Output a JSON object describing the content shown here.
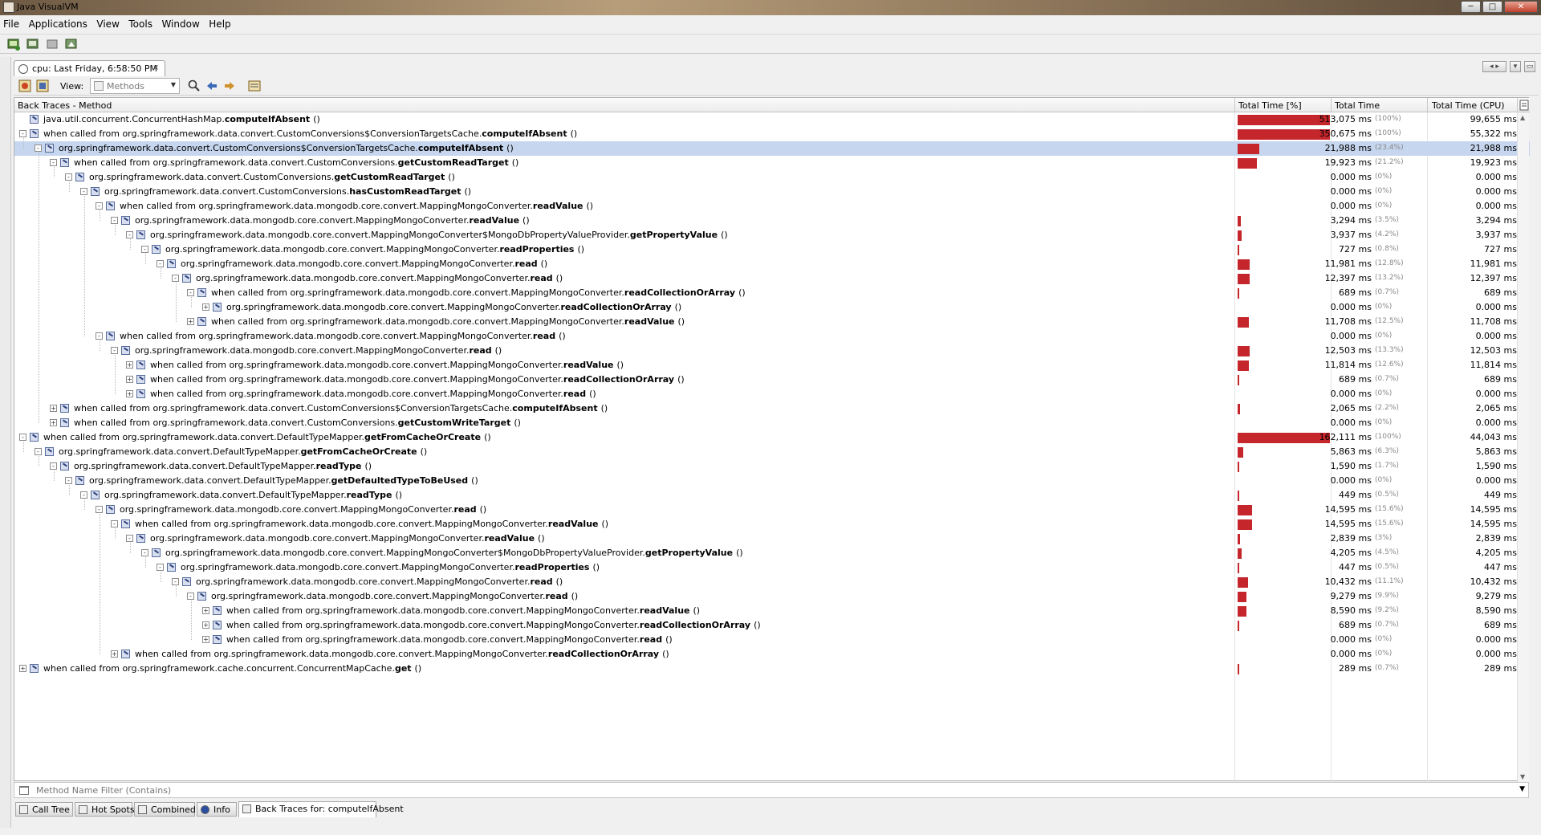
{
  "window": {
    "title": "Java VisualVM"
  },
  "menu": [
    "File",
    "Applications",
    "View",
    "Tools",
    "Window",
    "Help"
  ],
  "toolbar_icons": [
    "add-jmx-icon",
    "add-remote-host-icon",
    "add-snapshot-icon",
    "load-snapshot-icon"
  ],
  "doc_tab": {
    "label": "cpu: Last Friday, 6:58:50 PM",
    "close": "×"
  },
  "view": {
    "label": "View:",
    "selected": "Methods"
  },
  "columns": {
    "method": "Back Traces - Method",
    "total_pct": "Total Time [%]",
    "total": "Total Time",
    "cpu": "Total Time (CPU)"
  },
  "rows": [
    {
      "lvl": 0,
      "exp": "",
      "prefix": "java.util.concurrent.ConcurrentHashMap.",
      "method": "computeIfAbsent",
      "ms": "513,075 ms",
      "pct": "(100%)",
      "cpu": "99,655 ms",
      "bar": 1.0
    },
    {
      "lvl": 0,
      "exp": "-",
      "prefix": "when called from org.springframework.data.convert.CustomConversions$ConversionTargetsCache.",
      "method": "computeIfAbsent",
      "ms": "350,675 ms",
      "pct": "(100%)",
      "cpu": "55,322 ms",
      "bar": 1.0
    },
    {
      "lvl": 1,
      "exp": "-",
      "prefix": "org.springframework.data.convert.CustomConversions$ConversionTargetsCache.",
      "method": "computeIfAbsent",
      "ms": "21,988 ms",
      "pct": "(23.4%)",
      "cpu": "21,988 ms",
      "bar": 0.234,
      "sel": true
    },
    {
      "lvl": 2,
      "exp": "-",
      "prefix": "when called from org.springframework.data.convert.CustomConversions.",
      "method": "getCustomReadTarget",
      "ms": "19,923 ms",
      "pct": "(21.2%)",
      "cpu": "19,923 ms",
      "bar": 0.212
    },
    {
      "lvl": 3,
      "exp": "-",
      "prefix": "org.springframework.data.convert.CustomConversions.",
      "method": "getCustomReadTarget",
      "ms": "0.000 ms",
      "pct": "(0%)",
      "cpu": "0.000 ms",
      "bar": 0
    },
    {
      "lvl": 4,
      "exp": "-",
      "prefix": "org.springframework.data.convert.CustomConversions.",
      "method": "hasCustomReadTarget",
      "ms": "0.000 ms",
      "pct": "(0%)",
      "cpu": "0.000 ms",
      "bar": 0
    },
    {
      "lvl": 5,
      "exp": "-",
      "prefix": "when called from org.springframework.data.mongodb.core.convert.MappingMongoConverter.",
      "method": "readValue",
      "ms": "0.000 ms",
      "pct": "(0%)",
      "cpu": "0.000 ms",
      "bar": 0
    },
    {
      "lvl": 6,
      "exp": "-",
      "prefix": "org.springframework.data.mongodb.core.convert.MappingMongoConverter.",
      "method": "readValue",
      "ms": "3,294 ms",
      "pct": "(3.5%)",
      "cpu": "3,294 ms",
      "bar": 0.035
    },
    {
      "lvl": 7,
      "exp": "-",
      "prefix": "org.springframework.data.mongodb.core.convert.MappingMongoConverter$MongoDbPropertyValueProvider.",
      "method": "getPropertyValue",
      "ms": "3,937 ms",
      "pct": "(4.2%)",
      "cpu": "3,937 ms",
      "bar": 0.042
    },
    {
      "lvl": 8,
      "exp": "-",
      "prefix": "org.springframework.data.mongodb.core.convert.MappingMongoConverter.",
      "method": "readProperties",
      "ms": "727 ms",
      "pct": "(0.8%)",
      "cpu": "727 ms",
      "bar": 0.008
    },
    {
      "lvl": 9,
      "exp": "-",
      "prefix": "org.springframework.data.mongodb.core.convert.MappingMongoConverter.",
      "method": "read",
      "ms": "11,981 ms",
      "pct": "(12.8%)",
      "cpu": "11,981 ms",
      "bar": 0.128
    },
    {
      "lvl": 10,
      "exp": "-",
      "prefix": "org.springframework.data.mongodb.core.convert.MappingMongoConverter.",
      "method": "read",
      "ms": "12,397 ms",
      "pct": "(13.2%)",
      "cpu": "12,397 ms",
      "bar": 0.132
    },
    {
      "lvl": 11,
      "exp": "-",
      "prefix": "when called from org.springframework.data.mongodb.core.convert.MappingMongoConverter.",
      "method": "readCollectionOrArray",
      "ms": "689 ms",
      "pct": "(0.7%)",
      "cpu": "689 ms",
      "bar": 0.007
    },
    {
      "lvl": 12,
      "exp": "+",
      "prefix": "org.springframework.data.mongodb.core.convert.MappingMongoConverter.",
      "method": "readCollectionOrArray",
      "ms": "0.000 ms",
      "pct": "(0%)",
      "cpu": "0.000 ms",
      "bar": 0
    },
    {
      "lvl": 11,
      "exp": "+",
      "prefix": "when called from org.springframework.data.mongodb.core.convert.MappingMongoConverter.",
      "method": "readValue",
      "ms": "11,708 ms",
      "pct": "(12.5%)",
      "cpu": "11,708 ms",
      "bar": 0.125
    },
    {
      "lvl": 5,
      "exp": "-",
      "prefix": "when called from org.springframework.data.mongodb.core.convert.MappingMongoConverter.",
      "method": "read",
      "ms": "0.000 ms",
      "pct": "(0%)",
      "cpu": "0.000 ms",
      "bar": 0
    },
    {
      "lvl": 6,
      "exp": "-",
      "prefix": "org.springframework.data.mongodb.core.convert.MappingMongoConverter.",
      "method": "read",
      "ms": "12,503 ms",
      "pct": "(13.3%)",
      "cpu": "12,503 ms",
      "bar": 0.133
    },
    {
      "lvl": 7,
      "exp": "+",
      "prefix": "when called from org.springframework.data.mongodb.core.convert.MappingMongoConverter.",
      "method": "readValue",
      "ms": "11,814 ms",
      "pct": "(12.6%)",
      "cpu": "11,814 ms",
      "bar": 0.126
    },
    {
      "lvl": 7,
      "exp": "+",
      "prefix": "when called from org.springframework.data.mongodb.core.convert.MappingMongoConverter.",
      "method": "readCollectionOrArray",
      "ms": "689 ms",
      "pct": "(0.7%)",
      "cpu": "689 ms",
      "bar": 0.007
    },
    {
      "lvl": 7,
      "exp": "+",
      "prefix": "when called from org.springframework.data.mongodb.core.convert.MappingMongoConverter.",
      "method": "read",
      "ms": "0.000 ms",
      "pct": "(0%)",
      "cpu": "0.000 ms",
      "bar": 0
    },
    {
      "lvl": 2,
      "exp": "+",
      "prefix": "when called from org.springframework.data.convert.CustomConversions$ConversionTargetsCache.",
      "method": "computeIfAbsent",
      "ms": "2,065 ms",
      "pct": "(2.2%)",
      "cpu": "2,065 ms",
      "bar": 0.022
    },
    {
      "lvl": 2,
      "exp": "+",
      "prefix": "when called from org.springframework.data.convert.CustomConversions.",
      "method": "getCustomWriteTarget",
      "ms": "0.000 ms",
      "pct": "(0%)",
      "cpu": "0.000 ms",
      "bar": 0
    },
    {
      "lvl": 0,
      "exp": "-",
      "prefix": "when called from org.springframework.data.convert.DefaultTypeMapper.",
      "method": "getFromCacheOrCreate",
      "ms": "162,111 ms",
      "pct": "(100%)",
      "cpu": "44,043 ms",
      "bar": 1.0
    },
    {
      "lvl": 1,
      "exp": "-",
      "prefix": "org.springframework.data.convert.DefaultTypeMapper.",
      "method": "getFromCacheOrCreate",
      "ms": "5,863 ms",
      "pct": "(6.3%)",
      "cpu": "5,863 ms",
      "bar": 0.063
    },
    {
      "lvl": 2,
      "exp": "-",
      "prefix": "org.springframework.data.convert.DefaultTypeMapper.",
      "method": "readType",
      "ms": "1,590 ms",
      "pct": "(1.7%)",
      "cpu": "1,590 ms",
      "bar": 0.017
    },
    {
      "lvl": 3,
      "exp": "-",
      "prefix": "org.springframework.data.convert.DefaultTypeMapper.",
      "method": "getDefaultedTypeToBeUsed",
      "ms": "0.000 ms",
      "pct": "(0%)",
      "cpu": "0.000 ms",
      "bar": 0
    },
    {
      "lvl": 4,
      "exp": "-",
      "prefix": "org.springframework.data.convert.DefaultTypeMapper.",
      "method": "readType",
      "ms": "449 ms",
      "pct": "(0.5%)",
      "cpu": "449 ms",
      "bar": 0.005
    },
    {
      "lvl": 5,
      "exp": "-",
      "prefix": "org.springframework.data.mongodb.core.convert.MappingMongoConverter.",
      "method": "read",
      "ms": "14,595 ms",
      "pct": "(15.6%)",
      "cpu": "14,595 ms",
      "bar": 0.156
    },
    {
      "lvl": 6,
      "exp": "-",
      "prefix": "when called from org.springframework.data.mongodb.core.convert.MappingMongoConverter.",
      "method": "readValue",
      "ms": "14,595 ms",
      "pct": "(15.6%)",
      "cpu": "14,595 ms",
      "bar": 0.156
    },
    {
      "lvl": 7,
      "exp": "-",
      "prefix": "org.springframework.data.mongodb.core.convert.MappingMongoConverter.",
      "method": "readValue",
      "ms": "2,839 ms",
      "pct": "(3%)",
      "cpu": "2,839 ms",
      "bar": 0.03
    },
    {
      "lvl": 8,
      "exp": "-",
      "prefix": "org.springframework.data.mongodb.core.convert.MappingMongoConverter$MongoDbPropertyValueProvider.",
      "method": "getPropertyValue",
      "ms": "4,205 ms",
      "pct": "(4.5%)",
      "cpu": "4,205 ms",
      "bar": 0.045
    },
    {
      "lvl": 9,
      "exp": "-",
      "prefix": "org.springframework.data.mongodb.core.convert.MappingMongoConverter.",
      "method": "readProperties",
      "ms": "447 ms",
      "pct": "(0.5%)",
      "cpu": "447 ms",
      "bar": 0.005
    },
    {
      "lvl": 10,
      "exp": "-",
      "prefix": "org.springframework.data.mongodb.core.convert.MappingMongoConverter.",
      "method": "read",
      "ms": "10,432 ms",
      "pct": "(11.1%)",
      "cpu": "10,432 ms",
      "bar": 0.111
    },
    {
      "lvl": 11,
      "exp": "-",
      "prefix": "org.springframework.data.mongodb.core.convert.MappingMongoConverter.",
      "method": "read",
      "ms": "9,279 ms",
      "pct": "(9.9%)",
      "cpu": "9,279 ms",
      "bar": 0.099
    },
    {
      "lvl": 12,
      "exp": "+",
      "prefix": "when called from org.springframework.data.mongodb.core.convert.MappingMongoConverter.",
      "method": "readValue",
      "ms": "8,590 ms",
      "pct": "(9.2%)",
      "cpu": "8,590 ms",
      "bar": 0.092
    },
    {
      "lvl": 12,
      "exp": "+",
      "prefix": "when called from org.springframework.data.mongodb.core.convert.MappingMongoConverter.",
      "method": "readCollectionOrArray",
      "ms": "689 ms",
      "pct": "(0.7%)",
      "cpu": "689 ms",
      "bar": 0.007
    },
    {
      "lvl": 12,
      "exp": "+",
      "prefix": "when called from org.springframework.data.mongodb.core.convert.MappingMongoConverter.",
      "method": "read",
      "ms": "0.000 ms",
      "pct": "(0%)",
      "cpu": "0.000 ms",
      "bar": 0
    },
    {
      "lvl": 6,
      "exp": "+",
      "prefix": "when called from org.springframework.data.mongodb.core.convert.MappingMongoConverter.",
      "method": "readCollectionOrArray",
      "ms": "0.000 ms",
      "pct": "(0%)",
      "cpu": "0.000 ms",
      "bar": 0
    },
    {
      "lvl": 0,
      "exp": "+",
      "prefix": "when called from org.springframework.cache.concurrent.ConcurrentMapCache.",
      "method": "get",
      "ms": "289 ms",
      "pct": "(0.7%)",
      "cpu": "289 ms",
      "bar": 0.007
    }
  ],
  "args_text": "()",
  "filter": {
    "placeholder": "Method Name Filter (Contains)"
  },
  "bottom_tabs": [
    "Call Tree",
    "Hot Spots",
    "Combined",
    "Info",
    "Back Traces for: computeIfAbsent"
  ],
  "colors": {
    "bar": "#c4262b",
    "selection": "#c6d6ee"
  }
}
